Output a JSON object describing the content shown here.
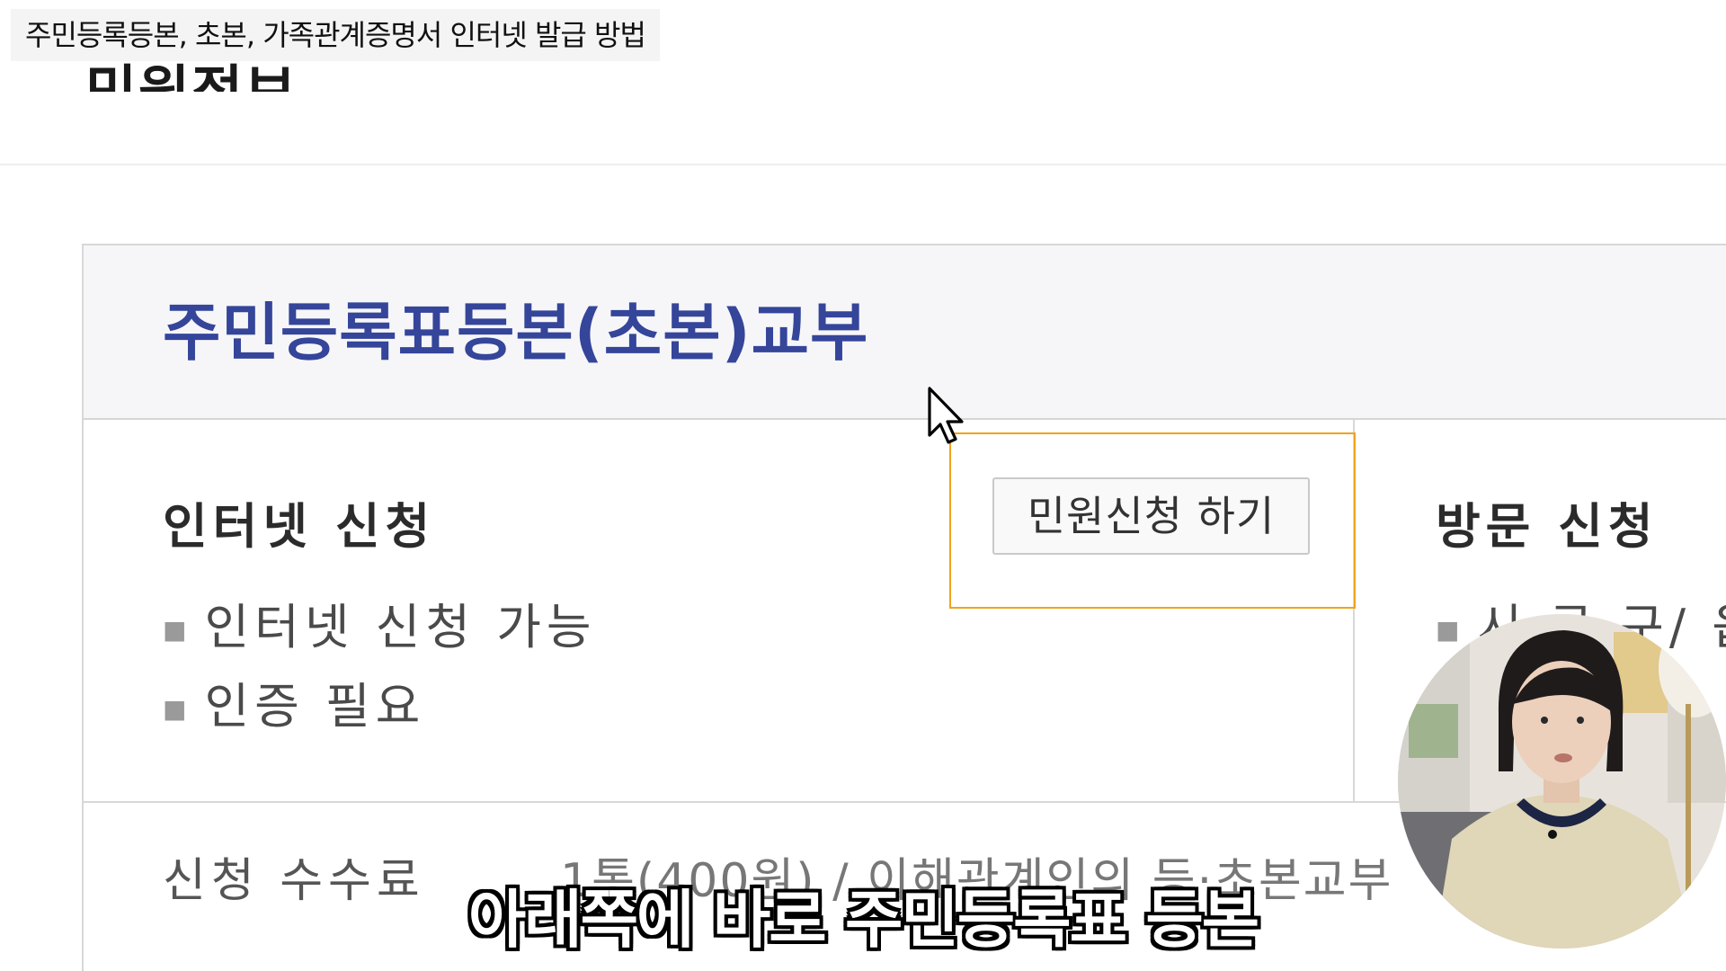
{
  "video": {
    "title": "주민등록등본, 초본, 가족관계증명서 인터넷 발급 방법",
    "subtitle": "아래쪽에 바로 주민등록표 등본"
  },
  "site": {
    "logo_text": "민원정보"
  },
  "service": {
    "title": "주민등록표등본(초본)교부",
    "internet": {
      "heading": "인터넷 신청",
      "bullets": [
        "인터넷 신청 가능",
        "인증 필요"
      ],
      "apply_button": "민원신청 하기"
    },
    "visit": {
      "heading": "방문 신청",
      "bullets": [
        "시·군·구/ 읍"
      ]
    },
    "fee": {
      "label": "신청 수수료",
      "value": "1통(400원) / 이해관계인의 등·초본교부"
    }
  },
  "colors": {
    "title_blue": "#34459a",
    "highlight": "#f0a31c",
    "header_bg": "#f6f6f8"
  },
  "icons": {
    "cursor": "mouse-pointer-icon",
    "bullet": "bullet-dot-icon"
  }
}
